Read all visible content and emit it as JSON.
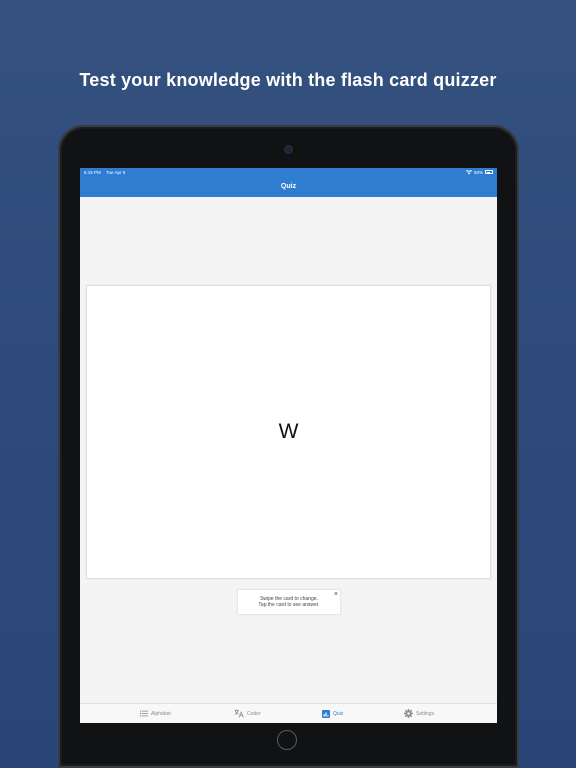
{
  "headline": "Test your knowledge with the flash card quizzer",
  "status_bar": {
    "time": "6:15 PM",
    "date": "Tue Apr 9",
    "battery": "50%"
  },
  "nav": {
    "title": "Quiz"
  },
  "card": {
    "letter": "W"
  },
  "hint": {
    "line1": "Swipe the card to change.",
    "line2": "Tap the card to see answer.",
    "close_icon": "×"
  },
  "tabs": [
    {
      "label": "Alphabet",
      "icon": "list-icon"
    },
    {
      "label": "Coder",
      "icon": "translate-icon"
    },
    {
      "label": "Quiz",
      "icon": "quiz-icon",
      "active": true
    },
    {
      "label": "Settings",
      "icon": "gear-icon"
    }
  ],
  "colors": {
    "accent": "#2f7dd0",
    "background": "#2d4a7b",
    "inactive_tab": "#8c8c8c"
  }
}
